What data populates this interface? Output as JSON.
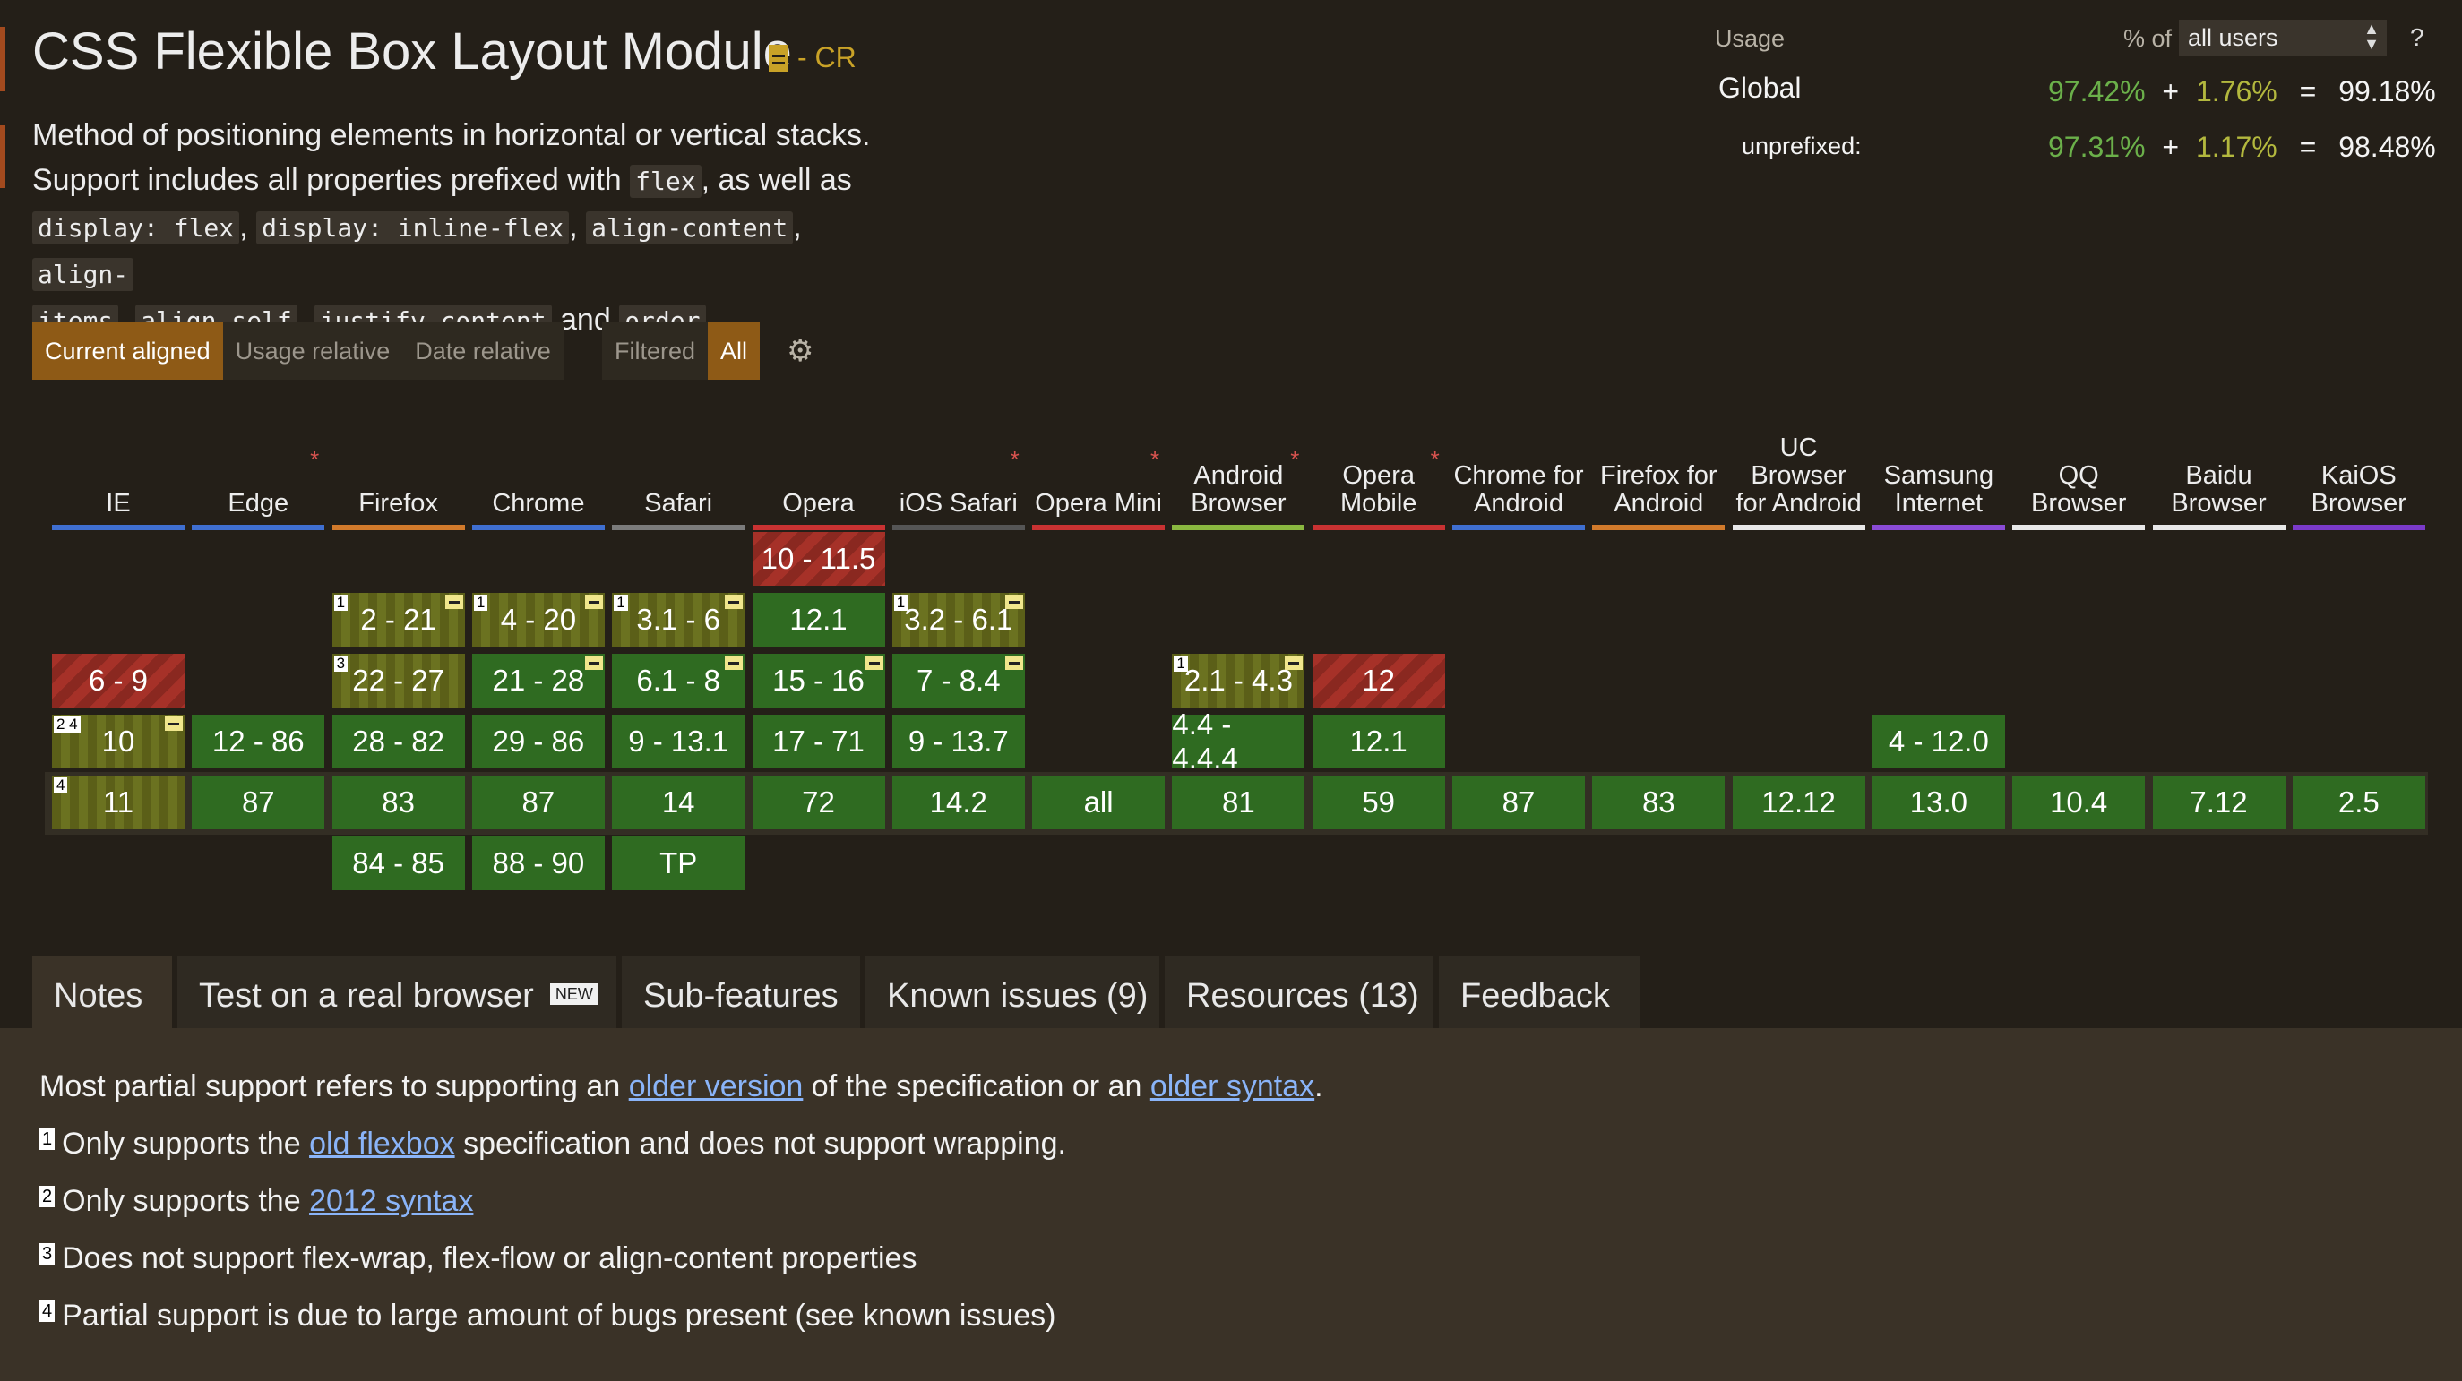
{
  "feature": {
    "title": "CSS Flexible Box Layout Module",
    "status": "- CR",
    "description": {
      "line1": "Method of positioning elements in horizontal or vertical stacks.",
      "line2a": "Support includes all properties prefixed with",
      "line2b": ", as well as",
      "code_flex": "flex",
      "code_display_flex": "display: flex",
      "code_inline_flex": "display: inline-flex",
      "code_align_content": "align-content",
      "code_align_items_1": "align-",
      "code_align_items_2": "items",
      "code_align_self": "align-self",
      "code_justify_content": "justify-content",
      "word_and": "and",
      "code_order": "order",
      "comma": ",",
      "period": "."
    }
  },
  "view_buttons": {
    "current_aligned": "Current aligned",
    "usage_relative": "Usage relative",
    "date_relative": "Date relative",
    "filtered": "Filtered",
    "all": "All"
  },
  "usage": {
    "label": "Usage",
    "pct_of": "% of",
    "selected_users": "all users",
    "help": "?",
    "global": {
      "label": "Global",
      "supported": "97.42%",
      "plus": "+",
      "partial": "1.76%",
      "equals": "=",
      "total": "99.18%"
    },
    "unprefixed": {
      "label": "unprefixed:",
      "supported": "97.31%",
      "plus": "+",
      "partial": "1.17%",
      "equals": "=",
      "total": "98.48%"
    }
  },
  "browsers": [
    {
      "name": "IE",
      "color": "#3f6fd1"
    },
    {
      "name": "Edge",
      "color": "#3f6fd1",
      "star": "*"
    },
    {
      "name": "Firefox",
      "color": "#d27a2b"
    },
    {
      "name": "Chrome",
      "color": "#3f6fd1"
    },
    {
      "name": "Safari",
      "color": "#7b7b7b"
    },
    {
      "name": "Opera",
      "color": "#c93232"
    },
    {
      "name": "iOS Safari",
      "color": "#555555",
      "star": "*"
    },
    {
      "name": "Opera Mini",
      "color": "#c93232",
      "star": "*"
    },
    {
      "name": "Android Browser",
      "color": "#8ab840",
      "star": "*"
    },
    {
      "name": "Opera Mobile",
      "color": "#c93232",
      "star": "*"
    },
    {
      "name": "Chrome for Android",
      "color": "#3f6fd1"
    },
    {
      "name": "Firefox for Android",
      "color": "#d27a2b"
    },
    {
      "name": "UC Browser for Android",
      "color": "#e8e8e8"
    },
    {
      "name": "Samsung Internet",
      "color": "#8a4bd6"
    },
    {
      "name": "QQ Browser",
      "color": "#e8e8e8"
    },
    {
      "name": "Baidu Browser",
      "color": "#e8e8e8"
    },
    {
      "name": "KaiOS Browser",
      "color": "#7a3ac9"
    }
  ],
  "cells": [
    {
      "browser": "Opera",
      "row": 0,
      "text": "10 - 11.5",
      "support": "n"
    },
    {
      "browser": "Firefox",
      "row": 1,
      "text": "2 - 21",
      "support": "a",
      "note": "1",
      "prefix": true
    },
    {
      "browser": "Chrome",
      "row": 1,
      "text": "4 - 20",
      "support": "a",
      "note": "1",
      "prefix": true
    },
    {
      "browser": "Safari",
      "row": 1,
      "text": "3.1 - 6",
      "support": "a",
      "note": "1",
      "prefix": true
    },
    {
      "browser": "Opera",
      "row": 1,
      "text": "12.1",
      "support": "y"
    },
    {
      "browser": "iOS Safari",
      "row": 1,
      "text": "3.2 - 6.1",
      "support": "a",
      "note": "1",
      "prefix": true
    },
    {
      "browser": "IE",
      "row": 2,
      "text": "6 - 9",
      "support": "n"
    },
    {
      "browser": "Firefox",
      "row": 2,
      "text": "22 - 27",
      "support": "a",
      "note": "3"
    },
    {
      "browser": "Chrome",
      "row": 2,
      "text": "21 - 28",
      "support": "y",
      "prefix": true
    },
    {
      "browser": "Safari",
      "row": 2,
      "text": "6.1 - 8",
      "support": "y",
      "prefix": true
    },
    {
      "browser": "Opera",
      "row": 2,
      "text": "15 - 16",
      "support": "y",
      "prefix": true
    },
    {
      "browser": "iOS Safari",
      "row": 2,
      "text": "7 - 8.4",
      "support": "y",
      "prefix": true
    },
    {
      "browser": "Android Browser",
      "row": 2,
      "text": "2.1 - 4.3",
      "support": "a",
      "note": "1",
      "prefix": true
    },
    {
      "browser": "Opera Mobile",
      "row": 2,
      "text": "12",
      "support": "n"
    },
    {
      "browser": "IE",
      "row": 3,
      "text": "10",
      "support": "a",
      "note": "2 4",
      "prefix": true
    },
    {
      "browser": "Edge",
      "row": 3,
      "text": "12 - 86",
      "support": "y"
    },
    {
      "browser": "Firefox",
      "row": 3,
      "text": "28 - 82",
      "support": "y"
    },
    {
      "browser": "Chrome",
      "row": 3,
      "text": "29 - 86",
      "support": "y"
    },
    {
      "browser": "Safari",
      "row": 3,
      "text": "9 - 13.1",
      "support": "y"
    },
    {
      "browser": "Opera",
      "row": 3,
      "text": "17 - 71",
      "support": "y"
    },
    {
      "browser": "iOS Safari",
      "row": 3,
      "text": "9 - 13.7",
      "support": "y"
    },
    {
      "browser": "Android Browser",
      "row": 3,
      "text": "4.4 - 4.4.4",
      "support": "y"
    },
    {
      "browser": "Opera Mobile",
      "row": 3,
      "text": "12.1",
      "support": "y"
    },
    {
      "browser": "Samsung Internet",
      "row": 3,
      "text": "4 - 12.0",
      "support": "y"
    },
    {
      "browser": "IE",
      "row": 4,
      "text": "11",
      "support": "a",
      "note": "4"
    },
    {
      "browser": "Edge",
      "row": 4,
      "text": "87",
      "support": "y"
    },
    {
      "browser": "Firefox",
      "row": 4,
      "text": "83",
      "support": "y"
    },
    {
      "browser": "Chrome",
      "row": 4,
      "text": "87",
      "support": "y"
    },
    {
      "browser": "Safari",
      "row": 4,
      "text": "14",
      "support": "y"
    },
    {
      "browser": "Opera",
      "row": 4,
      "text": "72",
      "support": "y"
    },
    {
      "browser": "iOS Safari",
      "row": 4,
      "text": "14.2",
      "support": "y"
    },
    {
      "browser": "Opera Mini",
      "row": 4,
      "text": "all",
      "support": "y"
    },
    {
      "browser": "Android Browser",
      "row": 4,
      "text": "81",
      "support": "y"
    },
    {
      "browser": "Opera Mobile",
      "row": 4,
      "text": "59",
      "support": "y"
    },
    {
      "browser": "Chrome for Android",
      "row": 4,
      "text": "87",
      "support": "y"
    },
    {
      "browser": "Firefox for Android",
      "row": 4,
      "text": "83",
      "support": "y"
    },
    {
      "browser": "UC Browser for Android",
      "row": 4,
      "text": "12.12",
      "support": "y"
    },
    {
      "browser": "Samsung Internet",
      "row": 4,
      "text": "13.0",
      "support": "y"
    },
    {
      "browser": "QQ Browser",
      "row": 4,
      "text": "10.4",
      "support": "y"
    },
    {
      "browser": "Baidu Browser",
      "row": 4,
      "text": "7.12",
      "support": "y"
    },
    {
      "browser": "KaiOS Browser",
      "row": 4,
      "text": "2.5",
      "support": "y"
    },
    {
      "browser": "Firefox",
      "row": 5,
      "text": "84 - 85",
      "support": "y"
    },
    {
      "browser": "Chrome",
      "row": 5,
      "text": "88 - 90",
      "support": "y"
    },
    {
      "browser": "Safari",
      "row": 5,
      "text": "TP",
      "support": "y"
    }
  ],
  "tabs": {
    "notes": "Notes",
    "test_real_browser": "Test on a real browser",
    "new_badge": "NEW",
    "sub_features": "Sub-features",
    "known_issues": "Known issues (9)",
    "resources": "Resources (13)",
    "feedback": "Feedback"
  },
  "notes": {
    "intro_a": "Most partial support refers to supporting an",
    "intro_link1": "older version",
    "intro_b": "of the specification or an",
    "intro_link2": "older syntax",
    "intro_c": ".",
    "n1_num": "1",
    "n1_a": "Only supports the",
    "n1_link": "old flexbox",
    "n1_b": "specification and does not support wrapping.",
    "n2_num": "2",
    "n2_a": "Only supports the",
    "n2_link": "2012 syntax",
    "n3_num": "3",
    "n3_text": "Does not support flex-wrap, flex-flow or align-content properties",
    "n4_num": "4",
    "n4_text": "Partial support is due to large amount of bugs present (see known issues)"
  }
}
